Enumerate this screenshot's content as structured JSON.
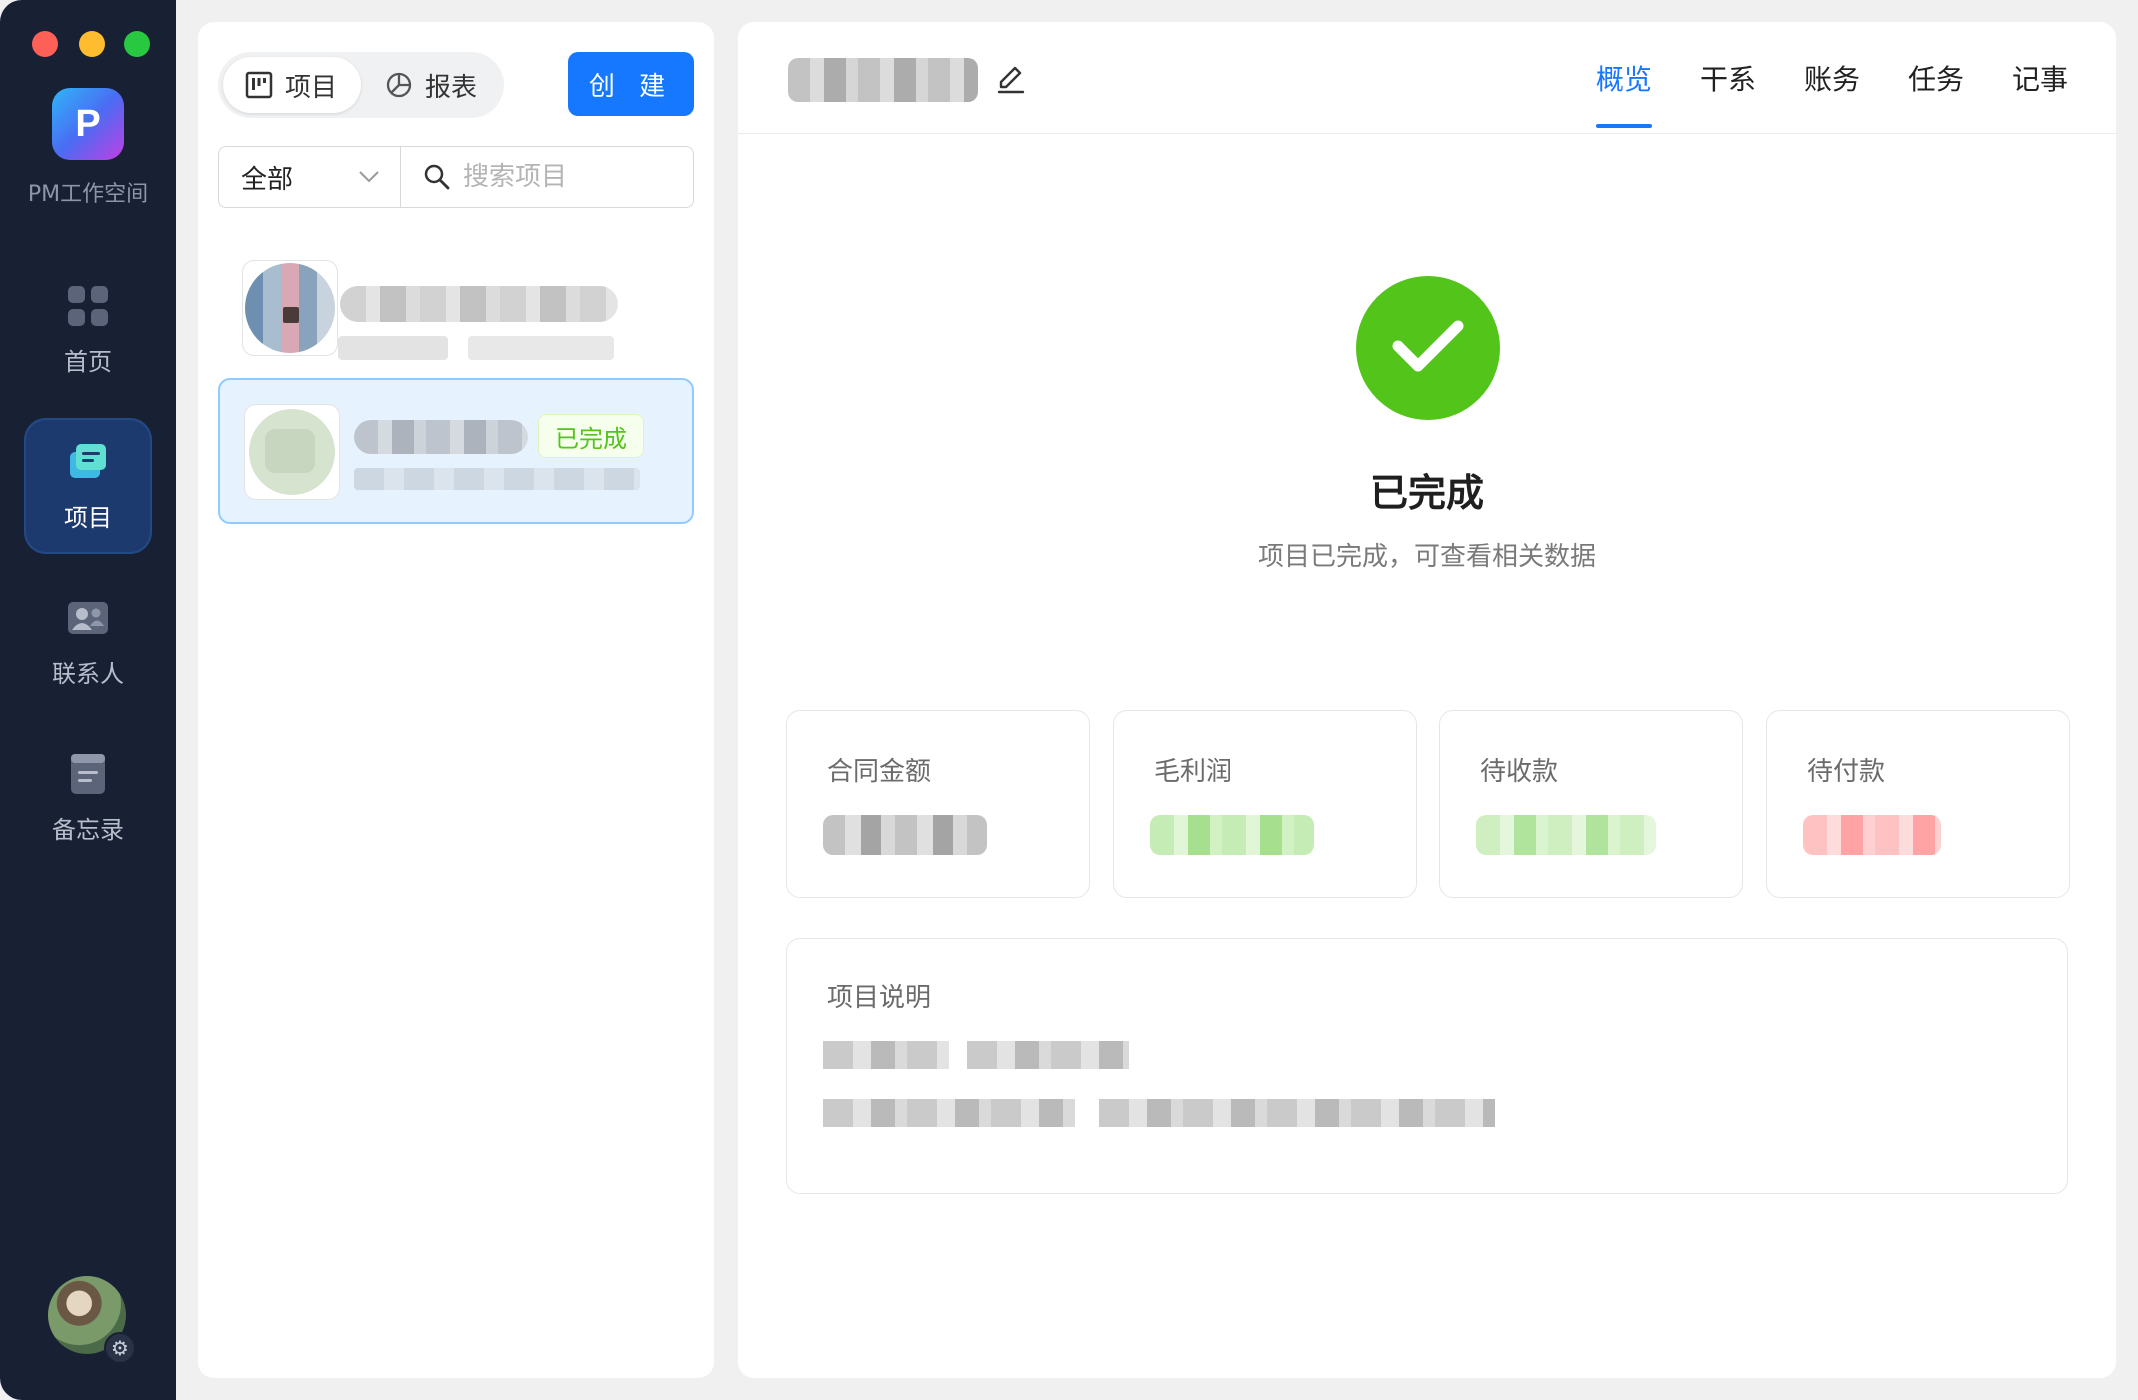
{
  "app": {
    "logo_letter": "P",
    "name": "PM工作空间"
  },
  "sidebar": {
    "items": [
      {
        "label": "首页",
        "icon": "grid-icon"
      },
      {
        "label": "项目",
        "icon": "project-icon",
        "active": true
      },
      {
        "label": "联系人",
        "icon": "contacts-icon"
      },
      {
        "label": "备忘录",
        "icon": "memo-icon"
      }
    ]
  },
  "list_panel": {
    "segments": [
      {
        "label": "项目",
        "icon": "board-icon",
        "active": true
      },
      {
        "label": "报表",
        "icon": "pie-chart-icon"
      }
    ],
    "create_label": "创 建",
    "filter": {
      "selected": "全部",
      "search_placeholder": "搜索项目"
    },
    "items": [
      {
        "status": "",
        "selected": false
      },
      {
        "status": "已完成",
        "selected": true
      }
    ]
  },
  "detail": {
    "tabs": [
      {
        "label": "概览",
        "active": true
      },
      {
        "label": "干系"
      },
      {
        "label": "账务"
      },
      {
        "label": "任务"
      },
      {
        "label": "记事"
      }
    ],
    "result": {
      "title": "已完成",
      "subtitle": "项目已完成，可查看相关数据"
    },
    "stats": [
      {
        "label": "合同金额",
        "value_color": "#9e9e9e"
      },
      {
        "label": "毛利润",
        "value_color": "#52c41a"
      },
      {
        "label": "待收款",
        "value_color": "#52c41a"
      },
      {
        "label": "待付款",
        "value_color": "#ff4d4f"
      }
    ],
    "description": {
      "title": "项目说明"
    }
  },
  "colors": {
    "sidebar_bg": "#182034",
    "primary": "#1677ff",
    "success": "#52c41a"
  }
}
